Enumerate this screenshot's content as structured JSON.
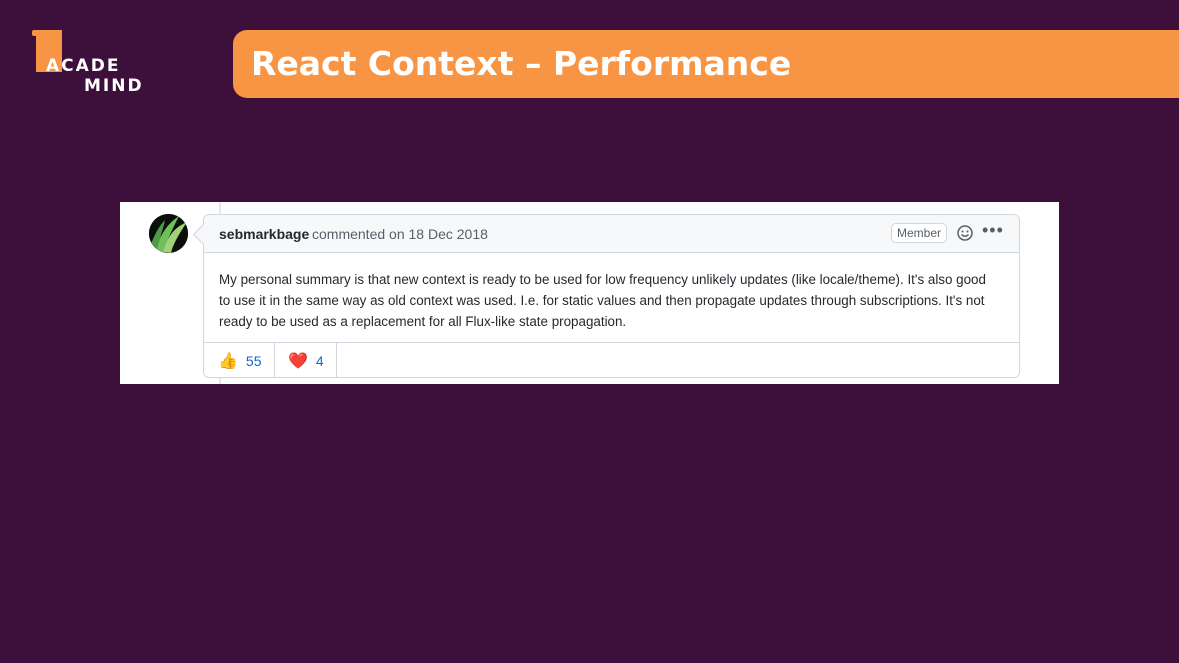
{
  "logo": {
    "line1": "ACADE",
    "line2": "MIND"
  },
  "banner": {
    "title": "React Context – Performance"
  },
  "comment": {
    "author": "sebmarkbage",
    "meta": "commented on 18 Dec 2018",
    "badge": "Member",
    "body": "My personal summary is that new context is ready to be used for low frequency unlikely updates (like locale/theme). It's also good to use it in the same way as old context was used. I.e. for static values and then propagate updates through subscriptions. It's not ready to be used as a replacement for all Flux-like state propagation.",
    "reactions": [
      {
        "emoji": "👍",
        "count": "55"
      },
      {
        "emoji": "❤️",
        "count": "4"
      }
    ]
  },
  "colors": {
    "background": "#3d0f3b",
    "accent": "#f79544",
    "link": "#0969da"
  }
}
